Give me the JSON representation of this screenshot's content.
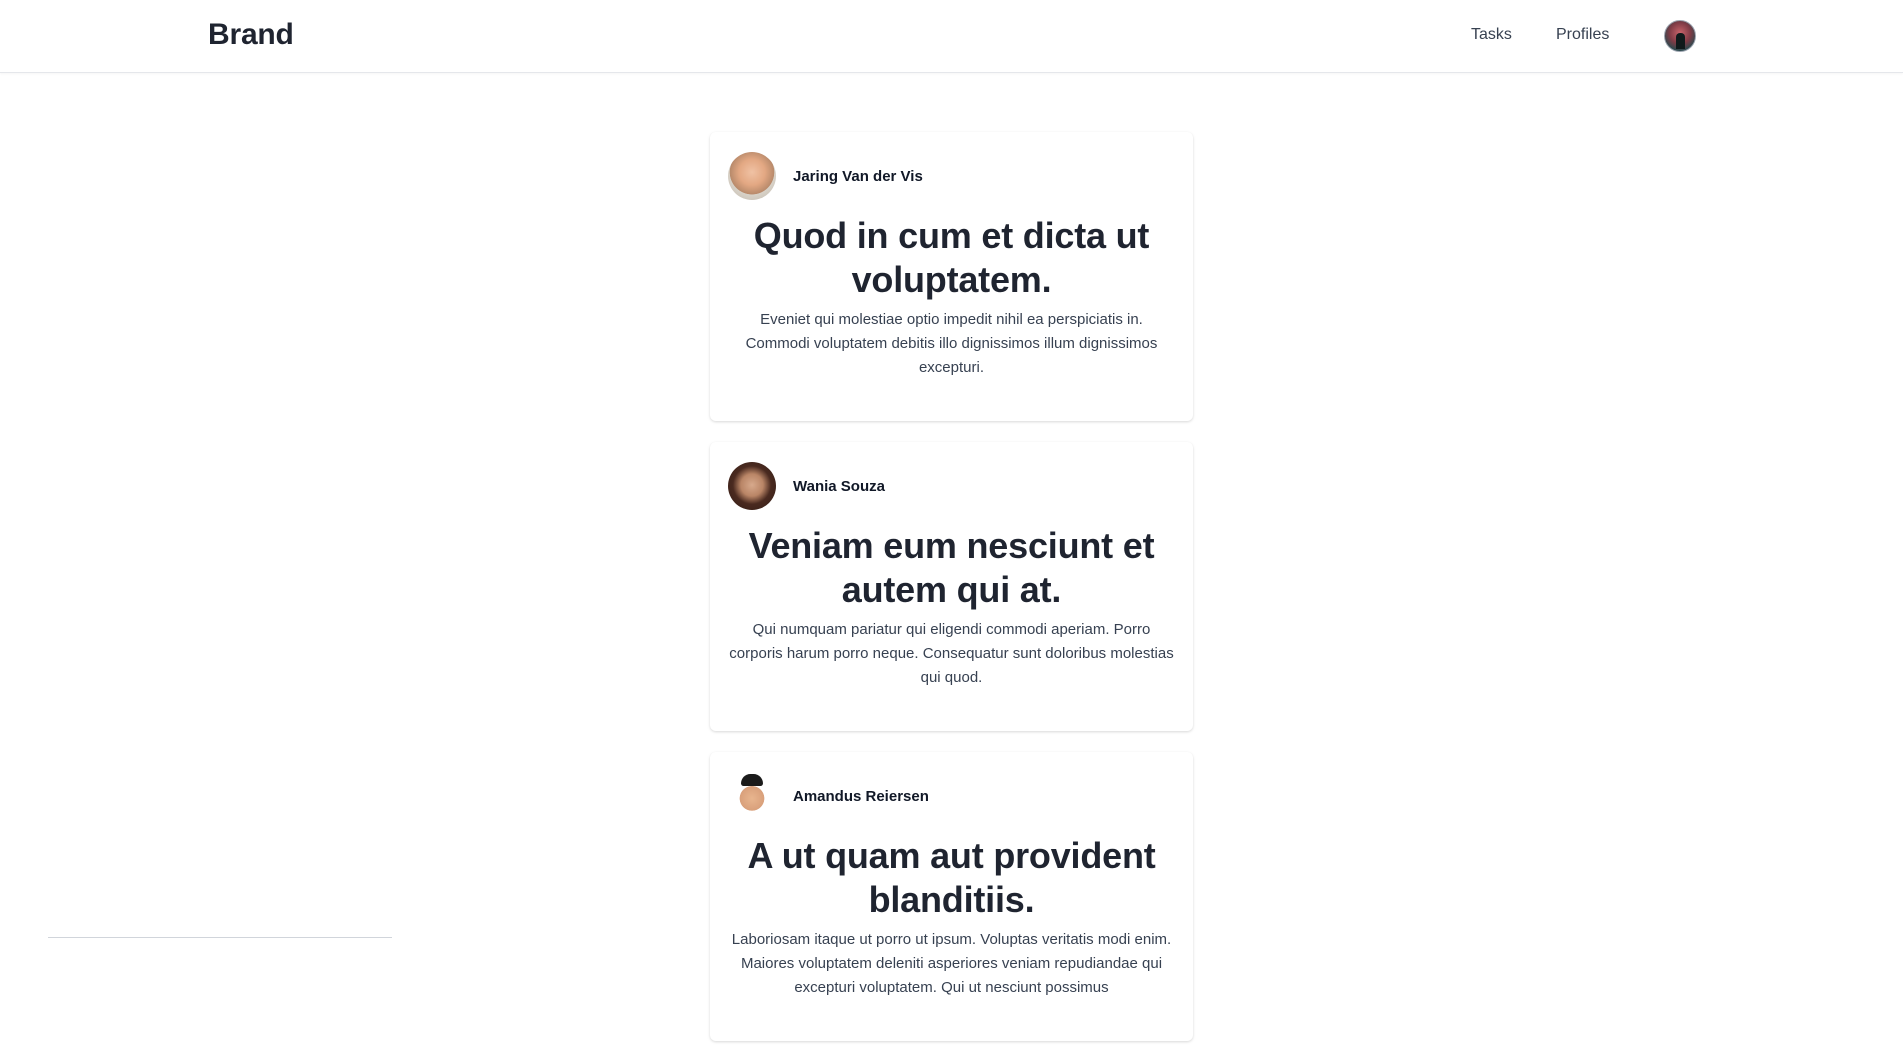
{
  "navbar": {
    "brand": "Brand",
    "links": [
      {
        "label": "Tasks"
      },
      {
        "label": "Profiles"
      }
    ],
    "avatar_icon": "user-avatar-icon"
  },
  "posts": [
    {
      "author": "Jaring Van der Vis",
      "title": "Quod in cum et dicta ut voluptatem.",
      "body": "Eveniet qui molestiae optio impedit nihil ea perspiciatis in. Commodi voluptatem debitis illo dignissimos illum dignissimos excepturi."
    },
    {
      "author": "Wania Souza",
      "title": "Veniam eum nesciunt et autem qui at.",
      "body": "Qui numquam pariatur qui eligendi commodi aperiam. Porro corporis harum porro neque. Consequatur sunt doloribus molestias qui quod."
    },
    {
      "author": "Amandus Reiersen",
      "title": "A ut quam aut provident blanditiis.",
      "body": "Laboriosam itaque ut porro ut ipsum. Voluptas veritatis modi enim. Maiores voluptatem deleniti asperiores veniam repudiandae qui excepturi voluptatem. Qui ut nesciunt possimus"
    }
  ]
}
